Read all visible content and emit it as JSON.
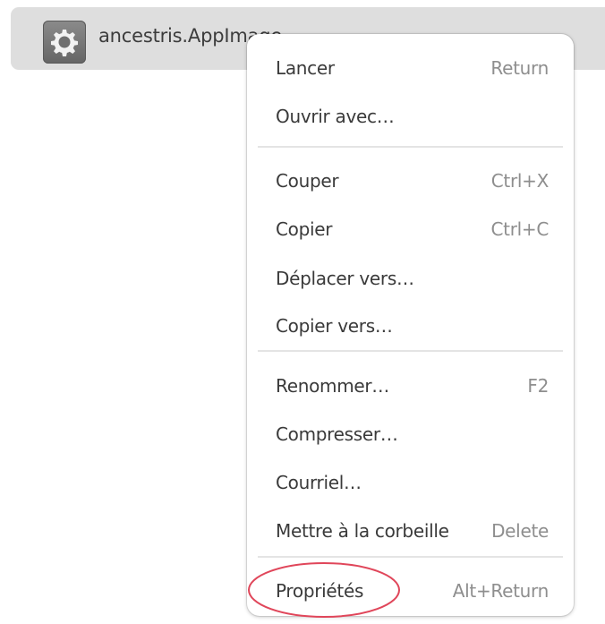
{
  "file": {
    "name": "ancestris.AppImage",
    "icon": "gear-icon"
  },
  "menu": {
    "items": [
      {
        "label": "Lancer",
        "accel": "Return"
      },
      {
        "label": "Ouvrir avec…",
        "accel": ""
      },
      {
        "label": "Couper",
        "accel": "Ctrl+X"
      },
      {
        "label": "Copier",
        "accel": "Ctrl+C"
      },
      {
        "label": "Déplacer vers…",
        "accel": ""
      },
      {
        "label": "Copier vers…",
        "accel": ""
      },
      {
        "label": "Renommer…",
        "accel": "F2"
      },
      {
        "label": "Compresser…",
        "accel": ""
      },
      {
        "label": "Courriel…",
        "accel": ""
      },
      {
        "label": "Mettre à la corbeille",
        "accel": "Delete"
      },
      {
        "label": "Propriétés",
        "accel": "Alt+Return"
      }
    ]
  },
  "colors": {
    "selection_background": "#dedede",
    "highlight_ellipse": "#e0465a",
    "accelerator_text": "#8e8e8e"
  }
}
